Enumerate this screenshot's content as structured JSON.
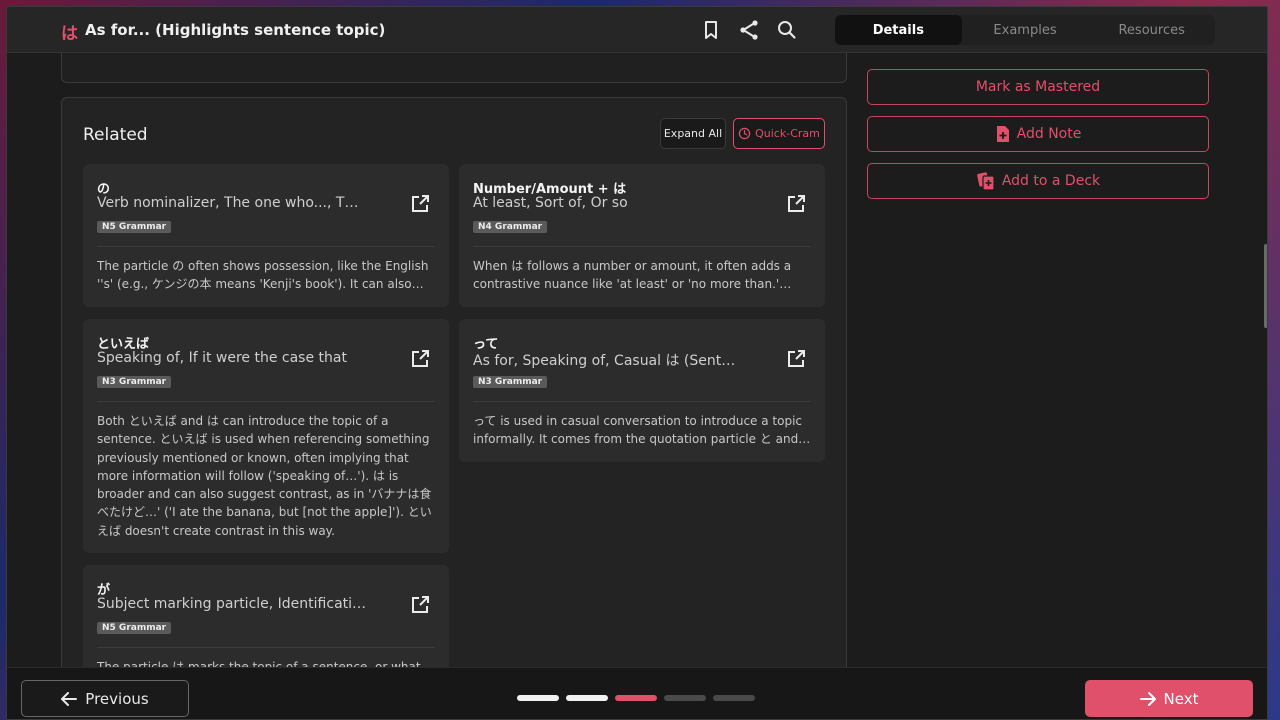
{
  "header": {
    "app_glyph": "は",
    "title": "As for... (Highlights sentence topic)",
    "icons": [
      "bookmark-icon",
      "share-icon",
      "search-icon"
    ],
    "tabs": [
      {
        "label": "Details",
        "active": true
      },
      {
        "label": "Examples",
        "active": false
      },
      {
        "label": "Resources",
        "active": false
      }
    ]
  },
  "related": {
    "heading": "Related",
    "expand_all_label": "Expand All",
    "quick_cram_label": "Quick-Cram",
    "cards": [
      {
        "term": "の",
        "meaning": "Verb nominalizer, The one who..., That…",
        "level": "N5 Grammar",
        "description": "The particle の often shows possession, like the English ''s' (e.g., ケンジの本 means 'Kenji's book'). It can also connec…"
      },
      {
        "term": "Number/Amount + は",
        "meaning": "At least, Sort of, Or so",
        "level": "N4 Grammar",
        "description": "When は follows a number or amount, it often adds a contrastive nuance like 'at least' or 'no more than.' For…"
      },
      {
        "term": "といえば",
        "meaning": "Speaking of, If it were the case that",
        "level": "N3 Grammar",
        "description": "Both といえば and は can introduce the topic of a sentence. といえば is used when referencing something previously mentioned or known, often implying that more information will follow ('speaking of…'). は is broader and can also suggest contrast, as in 'バナナは食べたけど…' ('I ate the banana, but [not the apple]'). といえば doesn't create contrast in this way."
      },
      {
        "term": "って",
        "meaning": "As for, Speaking of, Casual は (Sentence topi…",
        "level": "N3 Grammar",
        "description": "って is used in casual conversation to introduce a topic informally. It comes from the quotation particle と and ca…"
      },
      {
        "term": "が",
        "meaning": "Subject marking particle, Identification…",
        "level": "N5 Grammar",
        "description": "The particle は marks the topic of a sentence, or what the"
      }
    ]
  },
  "sidebar": {
    "mark_mastered_label": "Mark as Mastered",
    "add_note_label": "Add Note",
    "add_deck_label": "Add to a Deck"
  },
  "footer": {
    "previous_label": "Previous",
    "next_label": "Next",
    "progress": {
      "total": 5,
      "completed": 2,
      "current": 3
    }
  },
  "colors": {
    "accent": "#e0506a",
    "background": "#1c1c1c",
    "card": "#2c2c2c"
  }
}
